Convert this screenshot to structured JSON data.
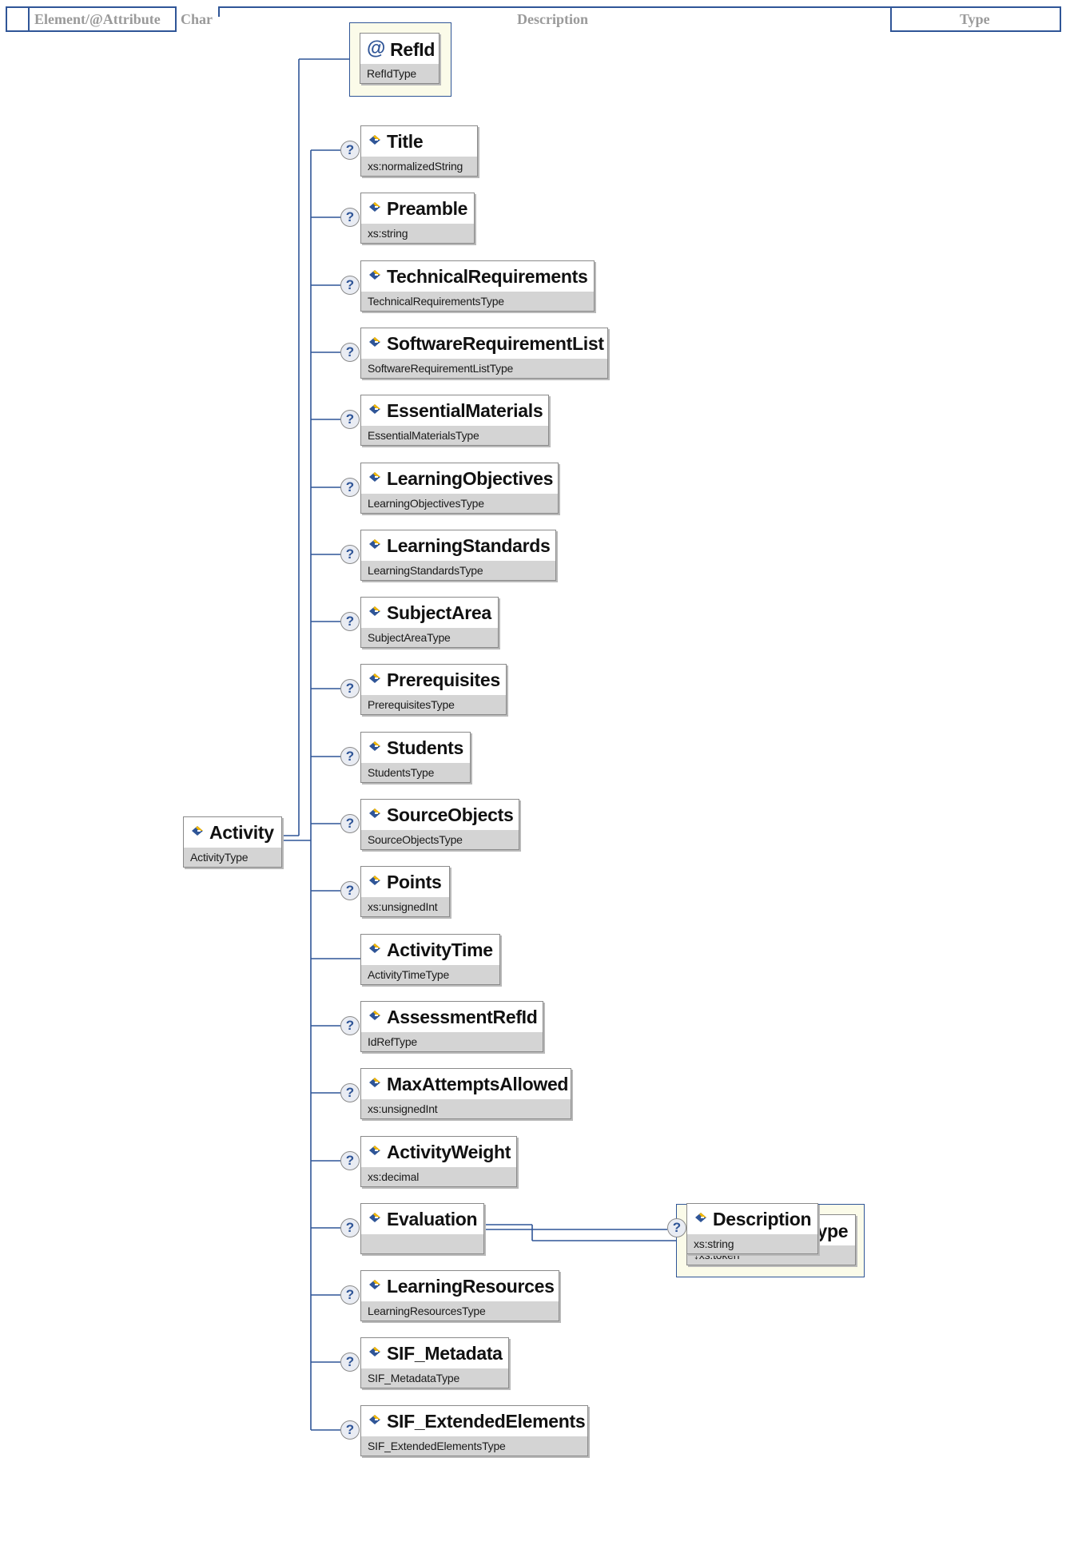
{
  "header": {
    "col_element": "Element/@Attribute",
    "col_char": "Char",
    "col_description": "Description",
    "col_type": "Type"
  },
  "root": {
    "name": "Activity",
    "type": "ActivityType"
  },
  "attributes": [
    {
      "name": "RefId",
      "type": "RefIdType"
    }
  ],
  "children": [
    {
      "name": "Title",
      "type": "xs:normalizedString",
      "optional": true
    },
    {
      "name": "Preamble",
      "type": "xs:string",
      "optional": true
    },
    {
      "name": "TechnicalRequirements",
      "type": "TechnicalRequirementsType",
      "optional": true
    },
    {
      "name": "SoftwareRequirementList",
      "type": "SoftwareRequirementListType",
      "optional": true
    },
    {
      "name": "EssentialMaterials",
      "type": "EssentialMaterialsType",
      "optional": true
    },
    {
      "name": "LearningObjectives",
      "type": "LearningObjectivesType",
      "optional": true
    },
    {
      "name": "LearningStandards",
      "type": "LearningStandardsType",
      "optional": true
    },
    {
      "name": "SubjectArea",
      "type": "SubjectAreaType",
      "optional": true
    },
    {
      "name": "Prerequisites",
      "type": "PrerequisitesType",
      "optional": true
    },
    {
      "name": "Students",
      "type": "StudentsType",
      "optional": true
    },
    {
      "name": "SourceObjects",
      "type": "SourceObjectsType",
      "optional": true
    },
    {
      "name": "Points",
      "type": "xs:unsignedInt",
      "optional": true
    },
    {
      "name": "ActivityTime",
      "type": "ActivityTimeType",
      "optional": false
    },
    {
      "name": "AssessmentRefId",
      "type": "IdRefType",
      "optional": true
    },
    {
      "name": "MaxAttemptsAllowed",
      "type": "xs:unsignedInt",
      "optional": true
    },
    {
      "name": "ActivityWeight",
      "type": "xs:decimal",
      "optional": true
    },
    {
      "name": "Evaluation",
      "type": "",
      "optional": true
    },
    {
      "name": "LearningResources",
      "type": "LearningResourcesType",
      "optional": true
    },
    {
      "name": "SIF_Metadata",
      "type": "SIF_MetadataType",
      "optional": true
    },
    {
      "name": "SIF_ExtendedElements",
      "type": "SIF_ExtendedElementsType",
      "optional": true
    }
  ],
  "evaluation": {
    "attribute": {
      "name": "EvaluationType",
      "type": "↓xs:token"
    },
    "child": {
      "name": "Description",
      "type": "xs:string",
      "optional": true
    }
  },
  "colors": {
    "line": "#2f5597",
    "icon_blue": "#2f5597",
    "icon_yellow": "#f2b705",
    "type_bar": "#d4d4d4"
  },
  "icons": {
    "element": "element-diamond-icon",
    "attribute": "at-icon",
    "optional": "question-icon"
  }
}
